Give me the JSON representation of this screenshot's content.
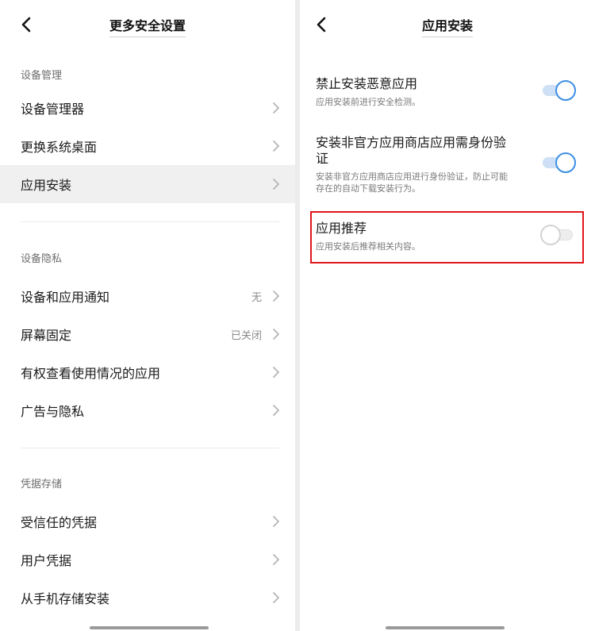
{
  "left": {
    "title": "更多安全设置",
    "sections": [
      {
        "label": "设备管理",
        "items": [
          {
            "label": "设备管理器",
            "value": ""
          },
          {
            "label": "更换系统桌面",
            "value": ""
          },
          {
            "label": "应用安装",
            "value": ""
          }
        ]
      },
      {
        "label": "设备隐私",
        "items": [
          {
            "label": "设备和应用通知",
            "value": "无"
          },
          {
            "label": "屏幕固定",
            "value": "已关闭"
          },
          {
            "label": "有权查看使用情况的应用",
            "value": ""
          },
          {
            "label": "广告与隐私",
            "value": ""
          }
        ]
      },
      {
        "label": "凭据存储",
        "items": [
          {
            "label": "受信任的凭据",
            "value": ""
          },
          {
            "label": "用户凭据",
            "value": ""
          },
          {
            "label": "从手机存储安装",
            "value": ""
          }
        ]
      }
    ]
  },
  "right": {
    "title": "应用安装",
    "settings": [
      {
        "title": "禁止安装恶意应用",
        "desc": "应用安装前进行安全检测。",
        "enabled": true
      },
      {
        "title": "安装非官方应用商店应用需身份验证",
        "desc": "安装非官方应用商店应用进行身份验证，防止可能存在的自动下载安装行为。",
        "enabled": true
      },
      {
        "title": "应用推荐",
        "desc": "应用安装后推荐相关内容。",
        "enabled": false
      }
    ]
  },
  "colors": {
    "accent": "#3b8fe4",
    "highlight": "#e0161b"
  },
  "icons": {
    "back": "back-arrow-icon",
    "chevron": "chevron-right-icon"
  }
}
